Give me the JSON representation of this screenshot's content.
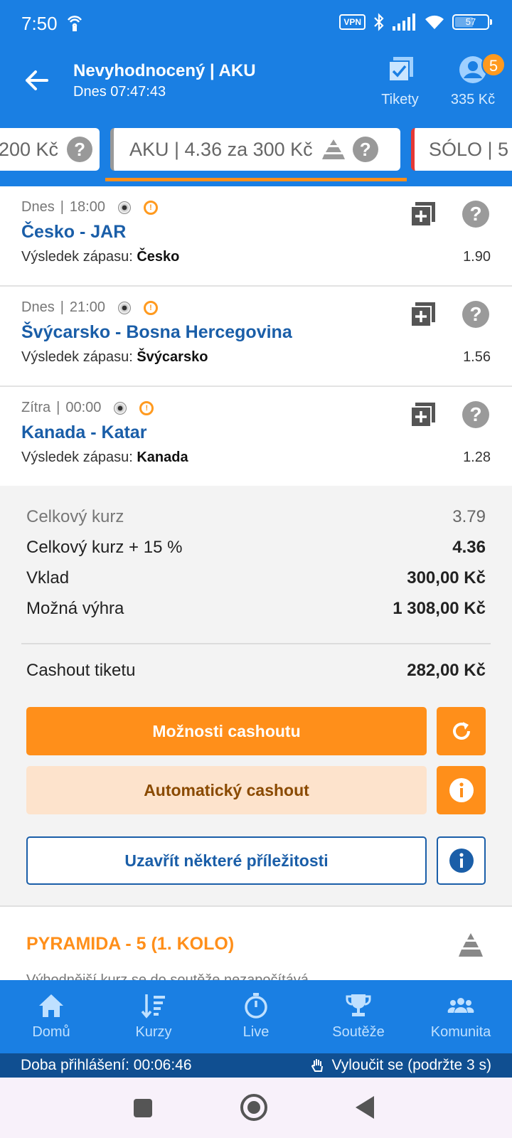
{
  "status_bar": {
    "time": "7:50",
    "vpn": "VPN",
    "battery": "57",
    "battery_level": 0.57
  },
  "header": {
    "title": "Nevyhodnocený | AKU",
    "subtitle": "Dnes 07:47:43",
    "tickets_label": "Tikety",
    "balance": "335 Kč",
    "notification_count": "5"
  },
  "tabs": [
    {
      "label": "200 Kč"
    },
    {
      "label": "AKU  | 4.36 za 300 Kč"
    },
    {
      "label": "SÓLO  | 5"
    }
  ],
  "events": [
    {
      "date": "Dnes",
      "time": "18:00",
      "name": "Česko - JAR",
      "result_label": "Výsledek zápasu:",
      "result_value": "Česko",
      "odd": "1.90"
    },
    {
      "date": "Dnes",
      "time": "21:00",
      "name": "Švýcarsko - Bosna Hercegovina",
      "result_label": "Výsledek zápasu:",
      "result_value": "Švýcarsko",
      "odd": "1.56"
    },
    {
      "date": "Zítra",
      "time": "00:00",
      "name": "Kanada - Katar",
      "result_label": "Výsledek zápasu:",
      "result_value": "Kanada",
      "odd": "1.28"
    }
  ],
  "summary": {
    "total_odds_label": "Celkový kurz",
    "total_odds": "3.79",
    "boosted_label": "Celkový kurz + 15 %",
    "boosted_odds": "4.36",
    "stake_label": "Vklad",
    "stake": "300,00 Kč",
    "win_label": "Možná výhra",
    "win": "1 308,00 Kč",
    "cashout_label": "Cashout tiketu",
    "cashout": "282,00 Kč",
    "cashout_options_button": "Možnosti cashoutu",
    "auto_cashout_button": "Automatický cashout",
    "close_button": "Uzavřít některé příležitosti"
  },
  "pyramid": {
    "title": "PYRAMIDA - 5 (1. KOLO)",
    "note": "Výhodnější kurz se do soutěže nezapočítává"
  },
  "bottom_nav": [
    {
      "label": "Domů",
      "icon": "home-icon"
    },
    {
      "label": "Kurzy",
      "icon": "odds-list-icon"
    },
    {
      "label": "Live",
      "icon": "stopwatch-icon"
    },
    {
      "label": "Soutěže",
      "icon": "trophy-icon"
    },
    {
      "label": "Komunita",
      "icon": "community-icon"
    }
  ],
  "login_bar": {
    "session": "Doba přihlášení: 00:06:46",
    "exclude": "Vyloučit se (podržte 3 s)"
  },
  "colors": {
    "primary_blue": "#1a7fe3",
    "orange": "#ff8f1a",
    "link_blue": "#1a5ea8"
  }
}
